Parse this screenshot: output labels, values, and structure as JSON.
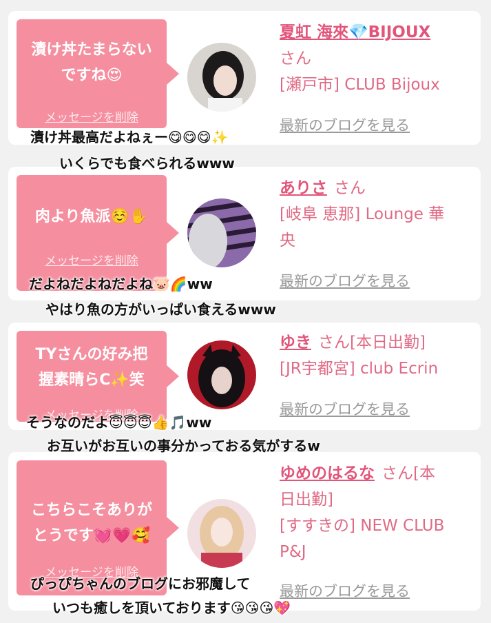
{
  "colors": {
    "bubble": "#f58f9f",
    "accent": "#e2557a",
    "card": "#ffffff",
    "background": "#f1f1f1",
    "link_gray": "#9a9a9a"
  },
  "cards": [
    {
      "bubble_line1": "漬け丼たまらない",
      "bubble_line2": "ですね😍",
      "delete_label": "メッセージを削除",
      "name": "夏虹 海來💎BIJOUX",
      "san": "さん",
      "store_line1": "[瀬戸市] CLUB Bijoux",
      "store_line2": "",
      "blog_label": "最新のブログを見る",
      "overlay_line1": "漬け丼最高だよねぇー😋😋😋✨",
      "overlay_line2": "いくらでも食べられるwww"
    },
    {
      "bubble_line1": "肉より魚派☺️✋",
      "bubble_line2": "",
      "delete_label": "メッセージを削除",
      "name": "ありさ",
      "san": "さん",
      "store_line1": "[岐阜 恵那] Lounge 華",
      "store_line2": "央",
      "blog_label": "最新のブログを見る",
      "overlay_line1": "だよねだよねだよね🐷🌈ww",
      "overlay_line2": "やはり魚の方がいっぱい食えるwww"
    },
    {
      "bubble_line1": "TYさんの好み把",
      "bubble_line2": "握素晴らC✨笑",
      "delete_label": "メッセージを削除",
      "name": "ゆき",
      "san": "さん[本日出勤]",
      "store_line1": "[JR宇都宮] club Ecrin",
      "store_line2": "",
      "blog_label": "最新のブログを見る",
      "overlay_line1": "そうなのだよ😇😇😇👍🎵ww",
      "overlay_line2": "お互いがお互いの事分かっておる気がするw"
    },
    {
      "bubble_line1": "こちらこそありが",
      "bubble_line2": "とうです💓💗🥰",
      "delete_label": "メッセージを削除",
      "name": "ゆめのはるな",
      "san": "さん[本",
      "san2": "日出勤]",
      "store_line1": "[すすきの] NEW CLUB",
      "store_line2": "P&J",
      "blog_label": "最新のブログを見る",
      "overlay_line1": "ぴっぴちゃんのブログにお邪魔して",
      "overlay_line2": "いつも癒しを頂いております😘😘😘💖"
    }
  ]
}
